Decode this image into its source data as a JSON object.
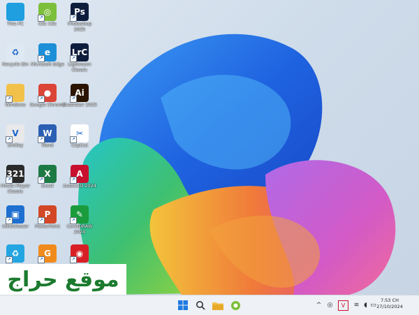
{
  "desktop": {
    "icons": [
      {
        "label": "This PC",
        "icon": "monitor-icon",
        "color": "#1f9ee0",
        "glyph": ""
      },
      {
        "label": "Recycle Bin",
        "icon": "recycle-bin-icon",
        "color": "#dfe9f3",
        "glyph": "♻"
      },
      {
        "label": "Windows",
        "icon": "folder-icon",
        "color": "#f2c14a",
        "glyph": ""
      },
      {
        "label": "UniKey",
        "icon": "unikey-icon",
        "color": "#e9e9e9",
        "glyph": "V"
      },
      {
        "label": "Media Player Classic",
        "icon": "media-player-icon",
        "color": "#2b2b2b",
        "glyph": "321"
      },
      {
        "label": "UltraViewer",
        "icon": "ultraviewer-icon",
        "color": "#1e6fd0",
        "glyph": "▣"
      },
      {
        "label": "",
        "icon": "recycle-icon",
        "color": "#22a5e0",
        "glyph": "♻"
      },
      {
        "label": "Cốc Cốc",
        "icon": "coccoc-icon",
        "color": "#7cbf3a",
        "glyph": "◎"
      },
      {
        "label": "Microsoft Edge",
        "icon": "edge-icon",
        "color": "#1d8fd8",
        "glyph": "e"
      },
      {
        "label": "Google Chrome",
        "icon": "chrome-icon",
        "color": "#db4437",
        "glyph": "●"
      },
      {
        "label": "Word",
        "icon": "word-icon",
        "color": "#2b5fb4",
        "glyph": "W"
      },
      {
        "label": "Excel",
        "icon": "excel-icon",
        "color": "#1e7a44",
        "glyph": "X"
      },
      {
        "label": "PowerPoint",
        "icon": "powerpoint-icon",
        "color": "#d24726",
        "glyph": "P"
      },
      {
        "label": "",
        "icon": "foxit-icon",
        "color": "#f08a1c",
        "glyph": "G"
      },
      {
        "label": "Photoshop 2025",
        "icon": "photoshop-icon",
        "color": "#0f1d3d",
        "glyph": "Ps"
      },
      {
        "label": "Lightroom Classic",
        "icon": "lightroom-icon",
        "color": "#0f1d3d",
        "glyph": "LrC"
      },
      {
        "label": "Illustrator 2025",
        "icon": "illustrator-icon",
        "color": "#2b1400",
        "glyph": "Ai"
      },
      {
        "label": "CapCut",
        "icon": "capcut-icon",
        "color": "#ffffff",
        "glyph": "✂"
      },
      {
        "label": "AutoCAD 2024",
        "icon": "autocad-icon",
        "color": "#c8102e",
        "glyph": "A"
      },
      {
        "label": "CorelDRAW 2024",
        "icon": "coreldraw-icon",
        "color": "#1a9b3c",
        "glyph": "✎"
      },
      {
        "label": "",
        "icon": "eye-app-icon",
        "color": "#d81f26",
        "glyph": "◉"
      }
    ]
  },
  "watermark": {
    "text": "موقع حراج"
  },
  "taskbar": {
    "apps": [
      {
        "icon": "windows-start-icon",
        "color": "#1f7ae0"
      },
      {
        "icon": "search-icon",
        "color": "#333333"
      },
      {
        "icon": "file-explorer-icon",
        "color": "#f2c14a"
      },
      {
        "icon": "coccoc-icon",
        "color": "#7cbf3a"
      }
    ],
    "tray": [
      {
        "icon": "chevron-up-icon",
        "glyph": "^"
      },
      {
        "icon": "network-app-icon",
        "glyph": "◎"
      },
      {
        "icon": "unikey-tray-icon",
        "glyph": "V"
      },
      {
        "icon": "wifi-icon",
        "glyph": "≋"
      },
      {
        "icon": "speaker-icon",
        "glyph": "◖"
      },
      {
        "icon": "battery-icon",
        "glyph": "▭"
      }
    ],
    "clock": {
      "time": "7:53 CH",
      "date": "27/10/2024"
    }
  }
}
